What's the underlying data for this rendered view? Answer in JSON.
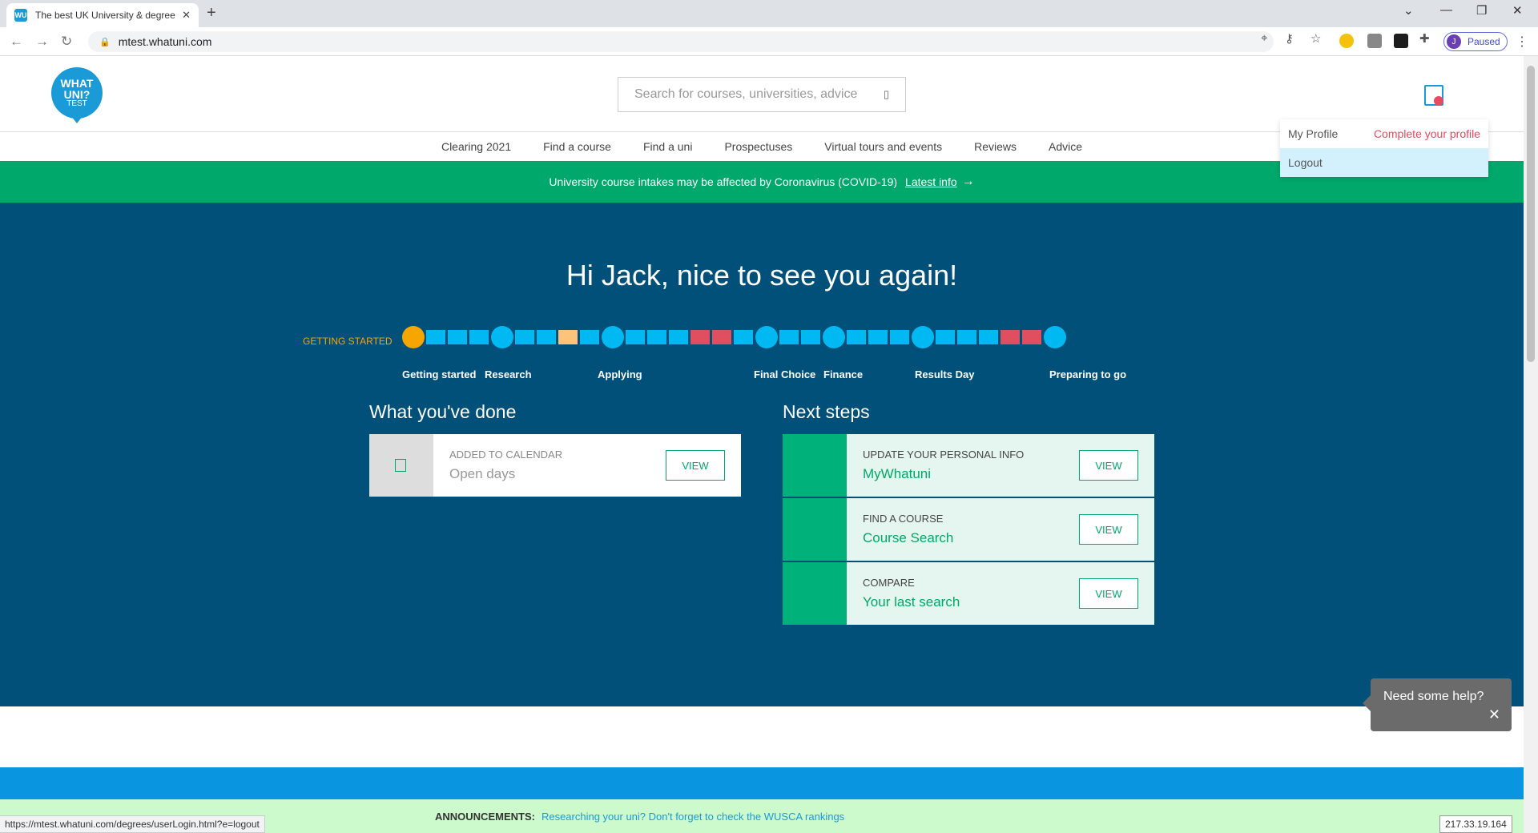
{
  "browser": {
    "tab_title": "The best UK University & degree",
    "tab_favicon": "WU",
    "url": "mtest.whatuni.com",
    "profile_initial": "J",
    "profile_status": "Paused",
    "status_url": "https://mtest.whatuni.com/degrees/userLogin.html?e=logout",
    "ip_address": "217.33.19.164"
  },
  "logo": {
    "line1": "WHAT",
    "line2": "UNI?",
    "line3": "TEST"
  },
  "search": {
    "placeholder": "Search for courses, universities, advice"
  },
  "nav": [
    "Clearing 2021",
    "Find a course",
    "Find a uni",
    "Prospectuses",
    "Virtual tours and events",
    "Reviews",
    "Advice"
  ],
  "covid": {
    "text": "University course intakes may be affected by Coronavirus (COVID-19)",
    "link": "Latest info"
  },
  "dropdown": {
    "my_profile": "My Profile",
    "complete_profile": "Complete your profile",
    "logout": "Logout"
  },
  "hero": {
    "greeting": "Hi Jack, nice to see you again!",
    "current_stage": "GETTING STARTED",
    "stages": [
      "Getting started",
      "Research",
      "Applying",
      "Final Choice",
      "Finance",
      "Results Day",
      "Preparing to go"
    ],
    "progress_steps": [
      "active-milestone",
      "step",
      "step",
      "step",
      "milestone",
      "step",
      "step",
      "partial",
      "step",
      "milestone",
      "step",
      "step",
      "step",
      "alert",
      "alert",
      "step",
      "milestone",
      "step",
      "step",
      "milestone",
      "step",
      "step",
      "step",
      "milestone",
      "step",
      "step",
      "step",
      "alert",
      "alert",
      "milestone"
    ],
    "done_title": "What you've done",
    "next_title": "Next steps",
    "done_cards": [
      {
        "category": "ADDED TO CALENDAR",
        "title": "Open days",
        "button": "VIEW"
      }
    ],
    "next_cards": [
      {
        "category": "UPDATE YOUR PERSONAL INFO",
        "title": "MyWhatuni",
        "button": "VIEW"
      },
      {
        "category": "FIND A COURSE",
        "title": "Course Search",
        "button": "VIEW"
      },
      {
        "category": "COMPARE",
        "title": "Your last search",
        "button": "VIEW"
      }
    ]
  },
  "announcement": {
    "label": "ANNOUNCEMENTS:",
    "text": "Researching your uni? Don't forget to check the WUSCA rankings"
  },
  "help": {
    "text": "Need some help?"
  },
  "colors": {
    "brand_blue": "#1a9ad6",
    "hero_bg": "#00507a",
    "green": "#00a86b",
    "progress_blue": "#00b9f2",
    "progress_orange": "#f7a600",
    "progress_alert": "#e04f5f",
    "progress_partial": "#fdc37a"
  }
}
